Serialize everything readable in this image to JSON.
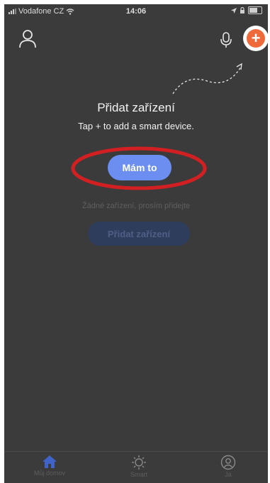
{
  "status_bar": {
    "carrier": "Vodafone CZ",
    "time": "14:06"
  },
  "topnav": {
    "profile_icon": "person-icon",
    "mic_icon": "microphone-icon",
    "add_icon": "plus-icon",
    "add_symbol": "+",
    "add_color": "#ef6a3a"
  },
  "tip": {
    "title": "Přidat zařízení",
    "subtitle": "Tap + to add a smart device.",
    "button_label": "Mám to"
  },
  "main": {
    "empty_text": "Žádné zařízení, prosím přidejte",
    "add_device_label": "Přidat zařízení"
  },
  "tabs": [
    {
      "label": "Můj domov",
      "icon": "home-icon",
      "active": true
    },
    {
      "label": "Smart",
      "icon": "sun-icon",
      "active": false
    },
    {
      "label": "Já",
      "icon": "profile-circle-icon",
      "active": false
    }
  ],
  "colors": {
    "overlay_bg": "#3b3b3b",
    "primary_button": "#6c8ef0",
    "highlight_ring": "#d21f22"
  }
}
